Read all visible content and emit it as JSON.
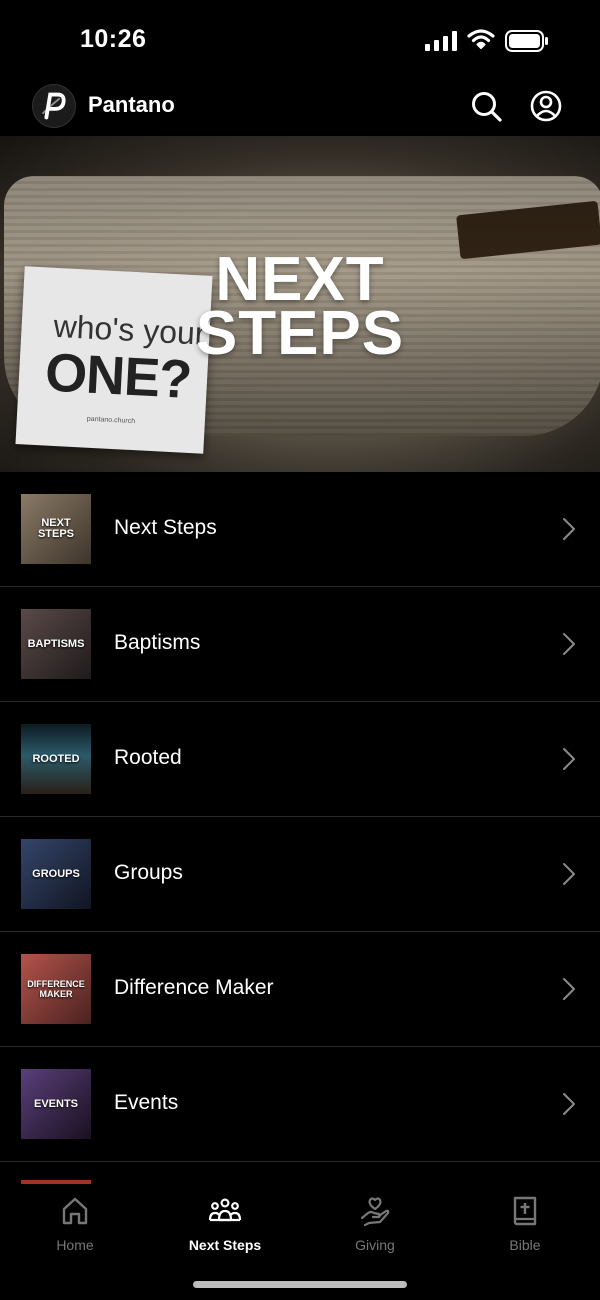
{
  "status_bar": {
    "time": "10:26"
  },
  "header": {
    "app_name": "Pantano"
  },
  "hero": {
    "title_line1": "NEXT",
    "title_line2": "STEPS",
    "card_line1": "who's your",
    "card_line2": "ONE?",
    "card_footer": "pantano.church"
  },
  "items": [
    {
      "label": "Next Steps",
      "thumb_text": "NEXT STEPS",
      "thumb_color": "#6e5f4f"
    },
    {
      "label": "Baptisms",
      "thumb_text": "BAPTISMS",
      "thumb_color": "#3b3030"
    },
    {
      "label": "Rooted",
      "thumb_text": "ROOTED",
      "thumb_color": "#1f3a45"
    },
    {
      "label": "Groups",
      "thumb_text": "GROUPS",
      "thumb_color": "#222b40"
    },
    {
      "label": "Difference Maker",
      "thumb_text": "DIFFERENCE MAKER",
      "thumb_color": "#8a3a32"
    },
    {
      "label": "Events",
      "thumb_text": "EVENTS",
      "thumb_color": "#40304f"
    }
  ],
  "tabs": [
    {
      "label": "Home",
      "icon": "home-icon",
      "active": false
    },
    {
      "label": "Next Steps",
      "icon": "people-group-icon",
      "active": true
    },
    {
      "label": "Giving",
      "icon": "heart-hand-icon",
      "active": false
    },
    {
      "label": "Bible",
      "icon": "bible-icon",
      "active": false
    }
  ],
  "colors": {
    "background": "#000000",
    "divider": "#2b2b2b",
    "tab_inactive": "#777777",
    "tab_active": "#ffffff"
  }
}
